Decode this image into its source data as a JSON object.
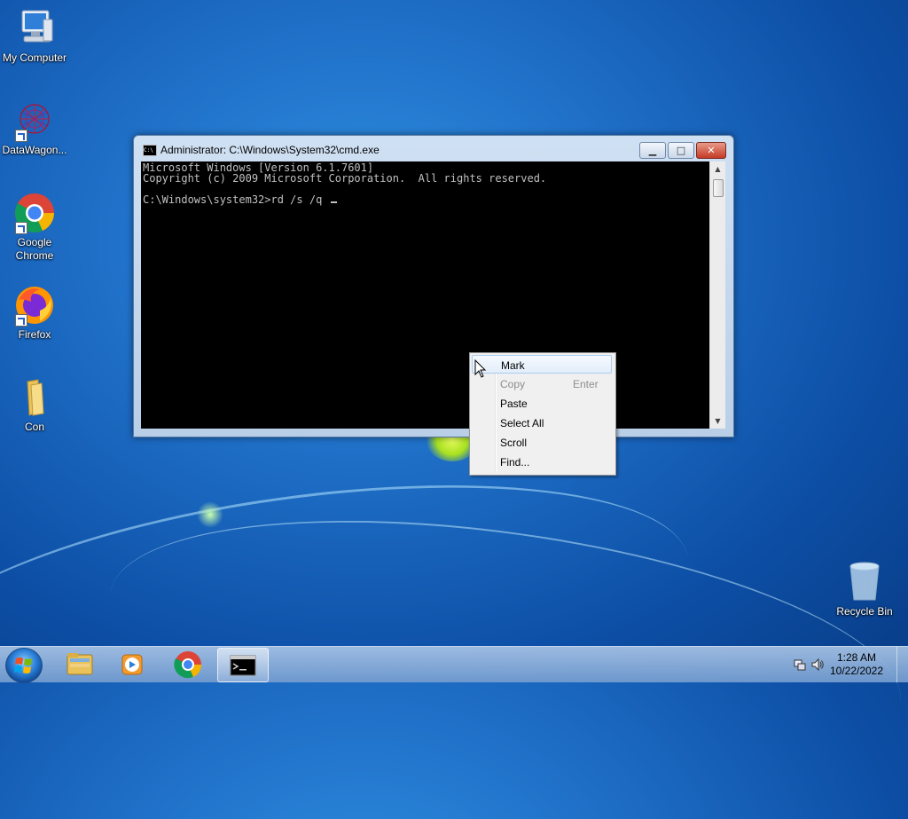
{
  "desktop": {
    "icons": [
      {
        "label": "My Computer",
        "icon": "computer-icon"
      },
      {
        "label": "DataWagon...",
        "icon": "datawagon-icon"
      },
      {
        "label": "Google Chrome",
        "icon": "chrome-icon"
      },
      {
        "label": "Firefox",
        "icon": "firefox-icon"
      },
      {
        "label": "Con",
        "icon": "folder-icon"
      },
      {
        "label": "Recycle Bin",
        "icon": "recycle-bin-icon"
      }
    ]
  },
  "cmd_window": {
    "title": "Administrator: C:\\Windows\\System32\\cmd.exe",
    "icon_text": "C:\\",
    "buttons": {
      "minimize": "▁",
      "maximize": "□",
      "close": "✕"
    },
    "lines": [
      "Microsoft Windows [Version 6.1.7601]",
      "Copyright (c) 2009 Microsoft Corporation.  All rights reserved.",
      "",
      "C:\\Windows\\system32>rd /s /q "
    ],
    "colors": {
      "background": "#000000",
      "text": "#c0c0c0"
    }
  },
  "context_menu": {
    "items": [
      {
        "label": "Mark",
        "shortcut": "",
        "enabled": true,
        "highlighted": true
      },
      {
        "label": "Copy",
        "shortcut": "Enter",
        "enabled": false,
        "highlighted": false
      },
      {
        "label": "Paste",
        "shortcut": "",
        "enabled": true,
        "highlighted": false
      },
      {
        "label": "Select All",
        "shortcut": "",
        "enabled": true,
        "highlighted": false
      },
      {
        "label": "Scroll",
        "shortcut": "",
        "enabled": true,
        "highlighted": false
      },
      {
        "label": "Find...",
        "shortcut": "",
        "enabled": true,
        "highlighted": false
      }
    ]
  },
  "taskbar": {
    "items": [
      {
        "name": "file-explorer",
        "icon": "folder-icon",
        "active": false
      },
      {
        "name": "media-player",
        "icon": "media-player-icon",
        "active": false
      },
      {
        "name": "chrome",
        "icon": "chrome-icon",
        "active": false
      },
      {
        "name": "cmd",
        "icon": "cmd-icon",
        "active": true
      }
    ],
    "clock": {
      "time": "1:28 AM",
      "date": "10/22/2022"
    }
  }
}
